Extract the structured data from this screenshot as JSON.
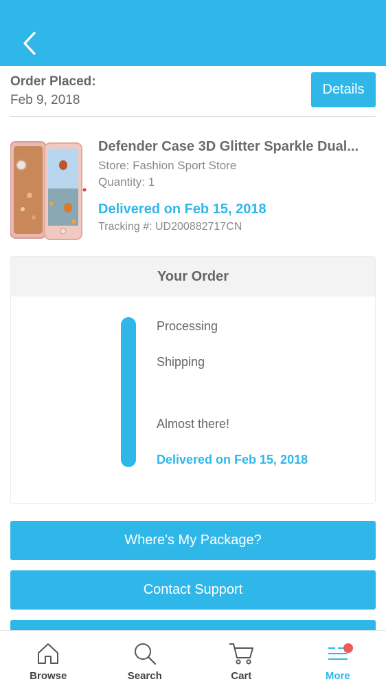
{
  "order": {
    "placed_label": "Order Placed:",
    "placed_date": "Feb 9, 2018",
    "details_label": "Details"
  },
  "product": {
    "title": "Defender Case 3D Glitter Sparkle Dual...",
    "store": "Store: Fashion Sport Store",
    "quantity": "Quantity: 1",
    "delivered": "Delivered on Feb 15, 2018",
    "tracking": "Tracking #: UD200882717CN"
  },
  "your_order": {
    "heading": "Your Order",
    "steps": [
      "Processing",
      "Shipping",
      "Almost there!",
      "Delivered on Feb 15, 2018"
    ]
  },
  "actions": {
    "where_label": "Where's My Package?",
    "contact_label": "Contact Support"
  },
  "tabbar": {
    "items": [
      {
        "label": "Browse",
        "icon": "home-icon"
      },
      {
        "label": "Search",
        "icon": "search-icon"
      },
      {
        "label": "Cart",
        "icon": "cart-icon"
      },
      {
        "label": "More",
        "icon": "menu-icon",
        "active": true
      }
    ]
  },
  "colors": {
    "accent": "#2fb7ea",
    "badge": "#ee5a5a"
  }
}
